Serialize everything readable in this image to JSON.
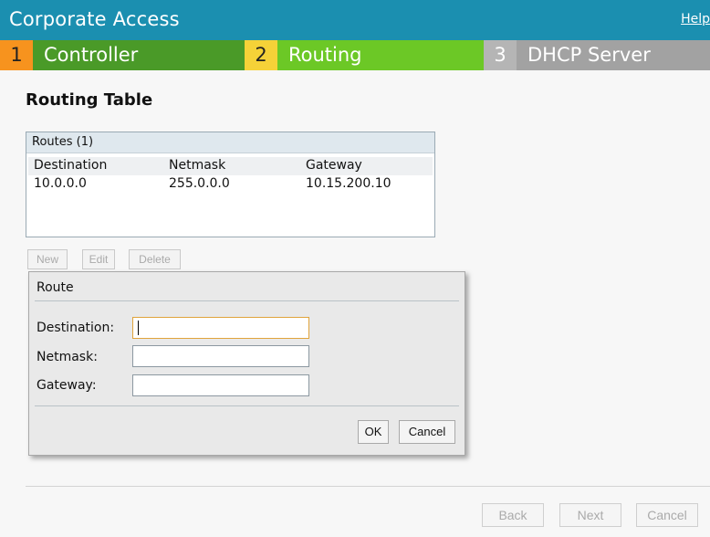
{
  "header": {
    "title": "Corporate Access",
    "help": "Help"
  },
  "steps": [
    {
      "num": "1",
      "label": "Controller"
    },
    {
      "num": "2",
      "label": "Routing"
    },
    {
      "num": "3",
      "label": "DHCP Server"
    }
  ],
  "section_title": "Routing Table",
  "routes": {
    "header": "Routes (1)",
    "columns": [
      "Destination",
      "Netmask",
      "Gateway"
    ],
    "rows": [
      [
        "10.0.0.0",
        "255.0.0.0",
        "10.15.200.10"
      ]
    ]
  },
  "table_buttons": {
    "new": "New",
    "edit": "Edit",
    "delete": "Delete"
  },
  "dialog": {
    "title": "Route",
    "fields": {
      "destination": {
        "label": "Destination:",
        "value": ""
      },
      "netmask": {
        "label": "Netmask:",
        "value": ""
      },
      "gateway": {
        "label": "Gateway:",
        "value": ""
      }
    },
    "ok": "OK",
    "cancel": "Cancel"
  },
  "footer": {
    "back": "Back",
    "next": "Next",
    "cancel": "Cancel"
  },
  "colors": {
    "titlebar": "#1b8fb0",
    "step1_num": "#f7931e",
    "step1": "#4a9a28",
    "step2_num": "#f5d238",
    "step2": "#6cc826",
    "step3_num": "#b5b5b5",
    "step3": "#a2a2a2"
  }
}
